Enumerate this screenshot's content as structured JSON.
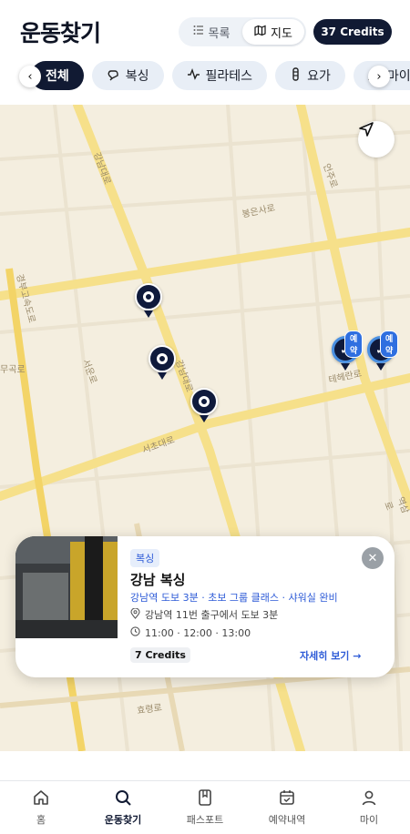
{
  "header": {
    "title": "운동찾기",
    "view_toggle": {
      "list_label": "목록",
      "map_label": "지도",
      "selected": "지도"
    },
    "credits": "37 Credits"
  },
  "categories": {
    "items": [
      {
        "label": "전체",
        "icon": "none",
        "active": true
      },
      {
        "label": "복싱",
        "icon": "boxing-glove-icon",
        "active": false
      },
      {
        "label": "필라테스",
        "icon": "pulse-icon",
        "active": false
      },
      {
        "label": "요가",
        "icon": "yoga-icon",
        "active": false
      },
      {
        "label": "마이",
        "icon": "mountain-icon",
        "active": false
      }
    ]
  },
  "map": {
    "labels": [
      "강남대로",
      "봉은사로",
      "테헤란로",
      "서초대로",
      "경부고속도로",
      "무곡로",
      "서운로",
      "강남대로",
      "효령로",
      "언주로",
      "역삼로"
    ],
    "pins": [
      {
        "type": "studio",
        "booked": false
      },
      {
        "type": "studio",
        "booked": false
      },
      {
        "type": "studio",
        "booked": false
      },
      {
        "type": "booked",
        "booked": true,
        "badge": "예약"
      },
      {
        "type": "booked",
        "booked": true,
        "badge": "예약"
      }
    ]
  },
  "card": {
    "tag": "복싱",
    "name": "강남 복싱",
    "features": "강남역 도보 3분 · 초보 그룹 클래스 · 샤워실 완비",
    "location": "강남역 11번 출구에서 도보 3분",
    "times": "11:00 · 12:00 · 13:00",
    "credits": "7 Credits",
    "more": "자세히 보기 →"
  },
  "nav": {
    "items": [
      {
        "label": "홈",
        "icon": "home-icon",
        "active": false
      },
      {
        "label": "운동찾기",
        "icon": "search-icon",
        "active": true
      },
      {
        "label": "패스포트",
        "icon": "passport-icon",
        "active": false
      },
      {
        "label": "예약내역",
        "icon": "calendar-check-icon",
        "active": false
      },
      {
        "label": "마이",
        "icon": "person-icon",
        "active": false
      }
    ]
  }
}
